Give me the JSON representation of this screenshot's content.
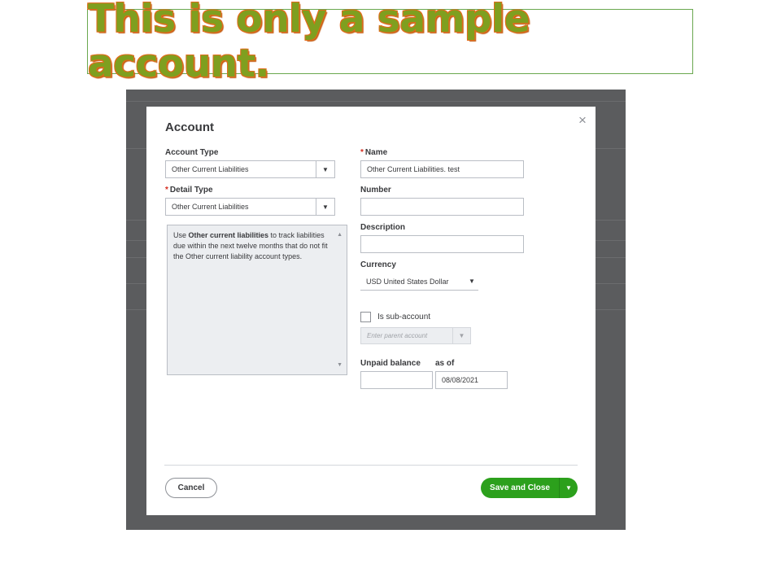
{
  "banner": {
    "text": "This is only a sample account."
  },
  "modal": {
    "title": "Account",
    "close_glyph": "×",
    "account_type": {
      "label": "Account Type",
      "value": "Other Current Liabilities"
    },
    "detail_type": {
      "label": "Detail Type",
      "required_mark": "*",
      "value": "Other Current Liabilities"
    },
    "detail_description": {
      "prefix": "Use ",
      "bold": "Other current liabilities",
      "suffix": " to track liabilities due within the next twelve months that do not fit the Other current liability account types."
    },
    "name": {
      "label": "Name",
      "required_mark": "*",
      "value": "Other Current Liabilities. test"
    },
    "number": {
      "label": "Number",
      "value": ""
    },
    "description": {
      "label": "Description",
      "value": ""
    },
    "currency": {
      "label": "Currency",
      "value": "USD United States Dollar"
    },
    "sub_account": {
      "label": "Is sub-account",
      "checked": false,
      "parent_placeholder": "Enter parent account"
    },
    "unpaid_balance": {
      "label": "Unpaid balance",
      "value": ""
    },
    "as_of": {
      "label": "as of",
      "value": "08/08/2021"
    },
    "buttons": {
      "cancel": "Cancel",
      "save": "Save and Close"
    },
    "icons": {
      "dropdown": "chevron-down-icon",
      "close": "close-icon"
    },
    "colors": {
      "primary": "#2ca01c",
      "required": "#d52b1e",
      "overlay": "#5b5c5e"
    }
  }
}
